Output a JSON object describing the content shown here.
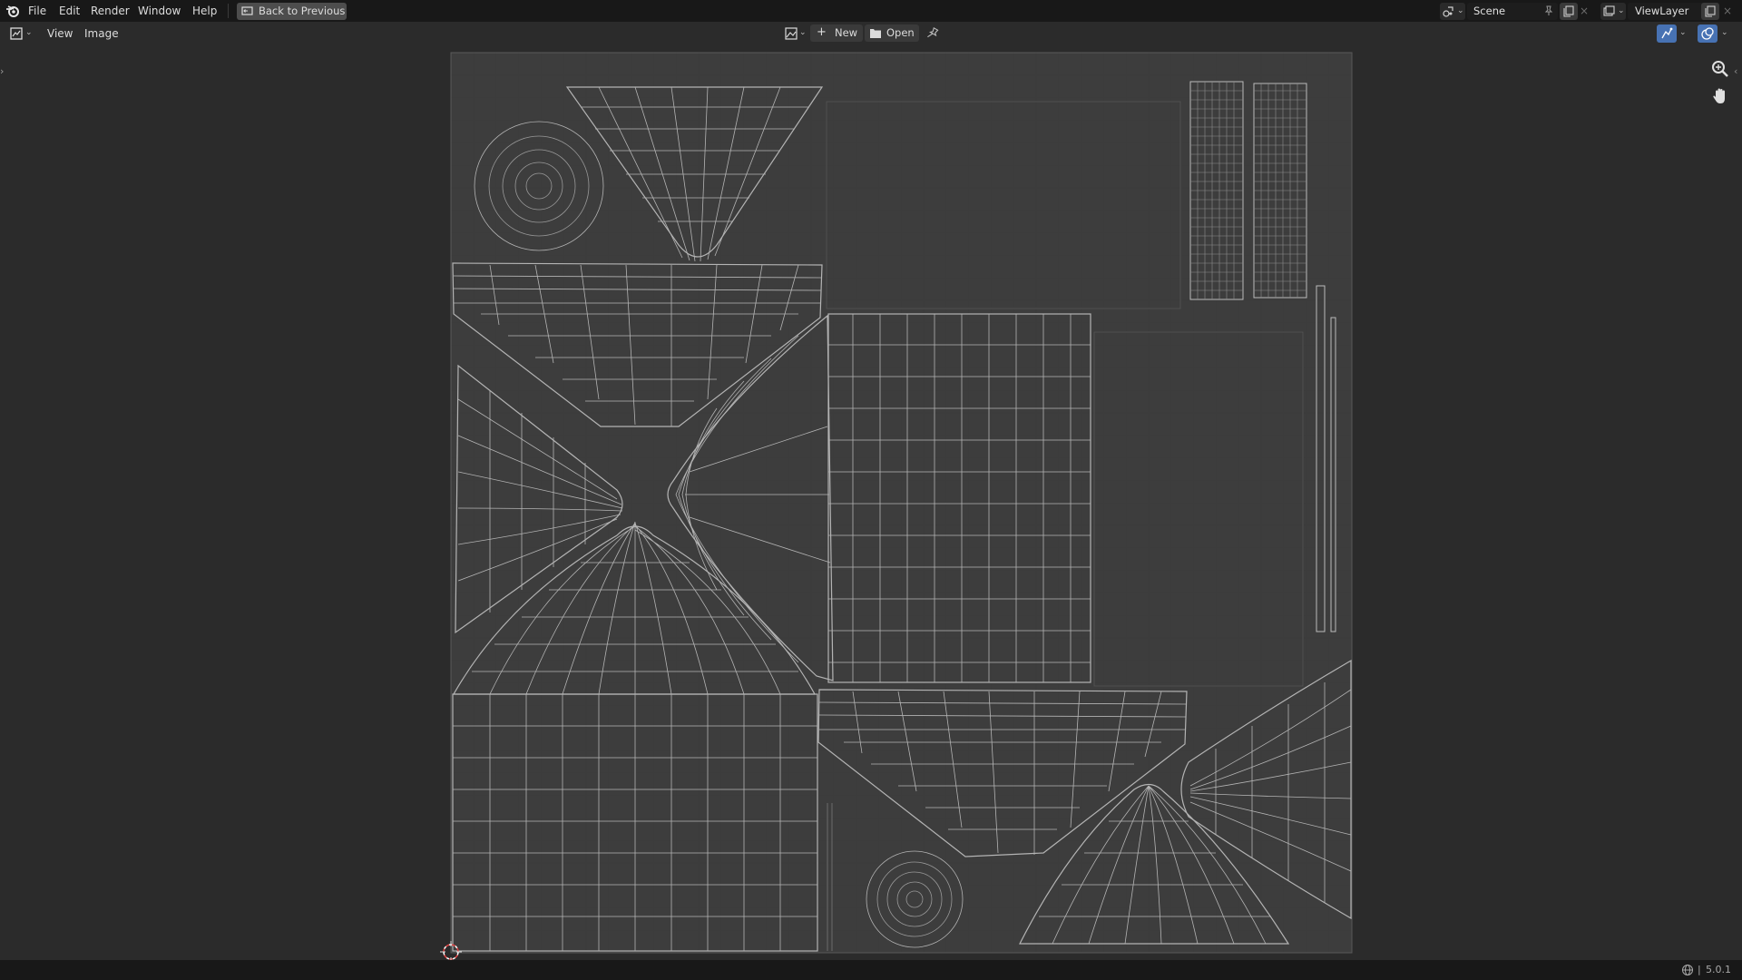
{
  "top_menu": {
    "items": [
      {
        "label": "File"
      },
      {
        "label": "Edit"
      },
      {
        "label": "Render"
      },
      {
        "label": "Window"
      },
      {
        "label": "Help"
      }
    ],
    "back_button": "Back to Previous"
  },
  "scene": {
    "name": "Scene"
  },
  "view_layer": {
    "name": "ViewLayer"
  },
  "editor_header": {
    "menus": [
      {
        "label": "View"
      },
      {
        "label": "Image"
      }
    ],
    "new_label": "New",
    "open_label": "Open"
  },
  "status": {
    "version": "5.0.1"
  },
  "icons": {
    "app": "blender-logo-icon",
    "editor_type": "image-editor-icon",
    "zoom": "zoom-icon",
    "pan": "hand-icon",
    "cursor": "2d-cursor-icon"
  },
  "colors": {
    "accent": "#4772b3",
    "wire": "#b4b4b4",
    "background": "#2b2b2b"
  }
}
